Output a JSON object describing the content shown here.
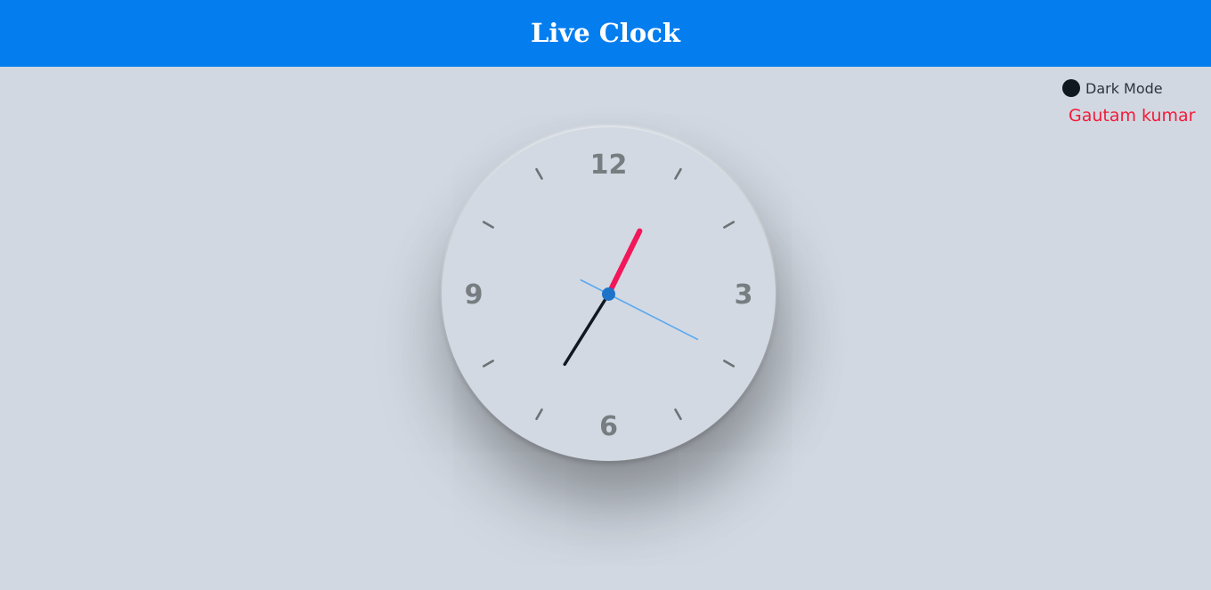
{
  "header": {
    "title": "Live Clock",
    "background": "#047eef"
  },
  "controls": {
    "dark_mode_label": "Dark Mode",
    "dark_mode_icon": "circle-toggle-icon"
  },
  "author": {
    "name": "Gautam kumar",
    "color": "#f51a39"
  },
  "clock": {
    "numerals": {
      "twelve": "12",
      "three": "3",
      "six": "6",
      "nine": "9"
    },
    "time": {
      "hours": 7,
      "minutes": 4,
      "seconds": 22
    },
    "colors": {
      "hour_hand": "#111820",
      "minute_hand": "#f2165a",
      "second_hand": "#5aa8f0",
      "center_dot": "#1e73c8"
    }
  }
}
